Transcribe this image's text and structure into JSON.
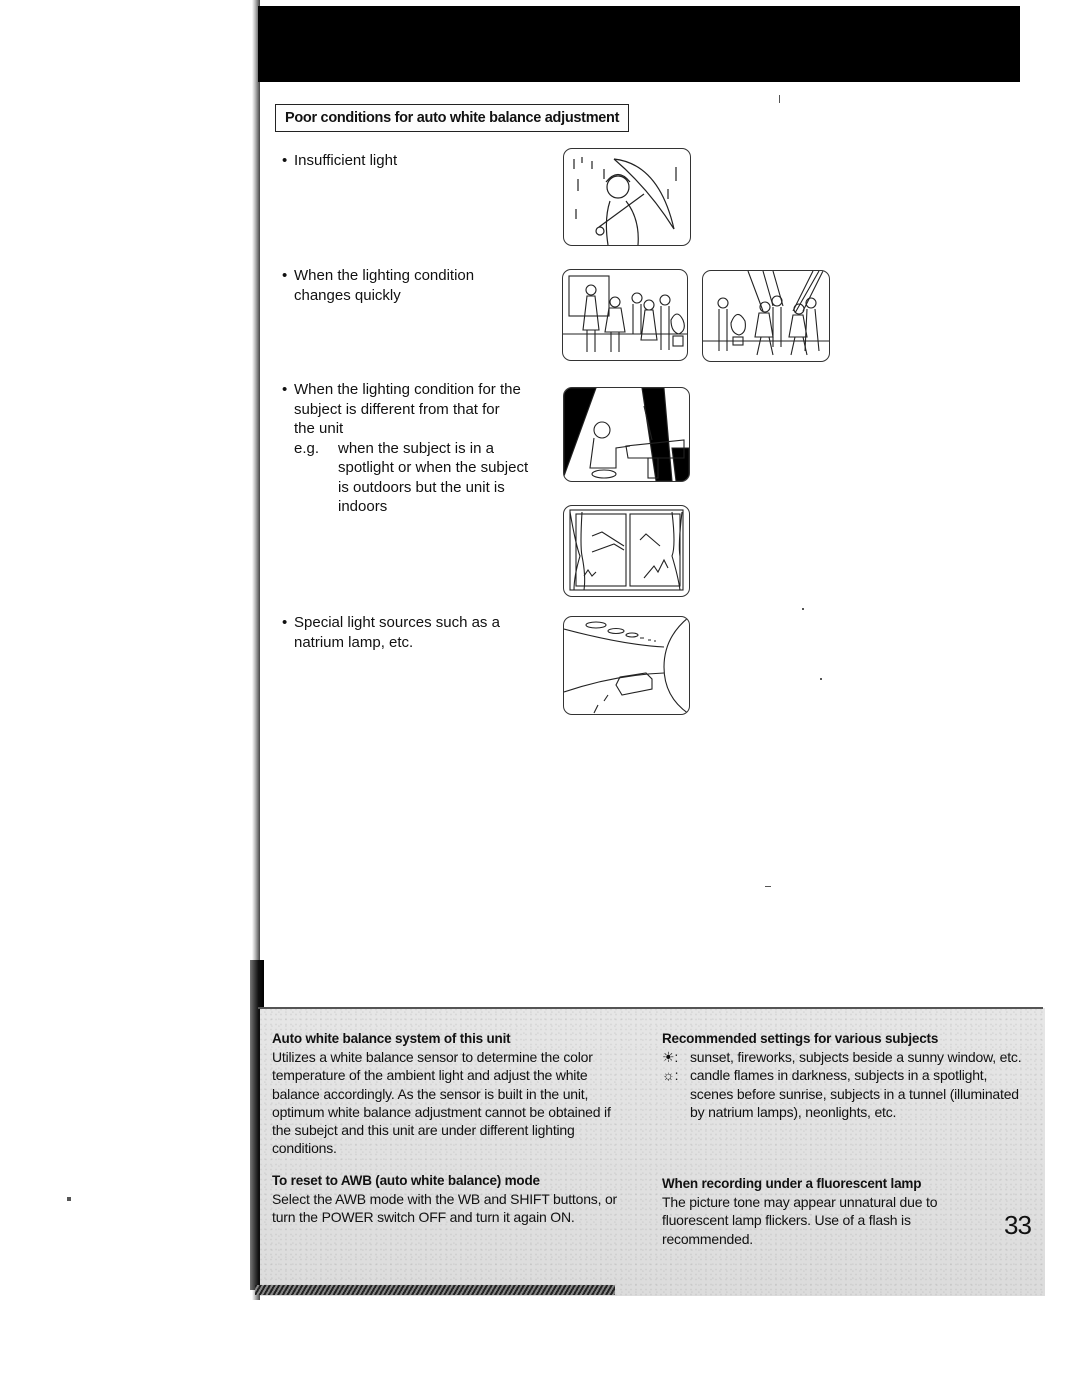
{
  "header": {
    "bar_text": ""
  },
  "section": {
    "title": "Poor conditions for auto white balance adjustment"
  },
  "conditions": [
    {
      "bullet": "•",
      "text": "Insufficient light",
      "illustration": "person-with-umbrella-in-rain-illustration"
    },
    {
      "bullet": "•",
      "text": "When the lighting condition\nchanges quickly",
      "illustrations": [
        "party-indoor-illustration",
        "dance-floor-spotlights-illustration"
      ]
    },
    {
      "bullet": "•",
      "text": "When the lighting condition for the\nsubject is different from that for\nthe unit",
      "example_label": "e.g.",
      "example_text": "when the subject is in a\nspotlight or when the subject\nis outdoors but the unit is\nindoors",
      "illustrations": [
        "pianist-in-spotlight-illustration",
        "window-with-curtains-illustration"
      ]
    },
    {
      "bullet": "•",
      "text": "Special light sources such as a\nnatrium lamp, etc.",
      "illustration": "car-in-tunnel-illustration"
    }
  ],
  "bottom": {
    "awb_system": {
      "heading": "Auto white balance system of this unit",
      "body": "Utilizes a white balance sensor to determine the color temperature of the ambient light and adjust the white balance accordingly. As the sensor is built in the unit, optimum white balance adjustment cannot be obtained if the subejct and this unit are under different lighting conditions."
    },
    "reset_awb": {
      "heading": "To reset to AWB (auto white balance) mode",
      "body": "Select the AWB mode with the WB and SHIFT buttons, or turn the POWER switch OFF and turn it again ON."
    },
    "recommended": {
      "heading": "Recommended settings for various subjects",
      "items": [
        {
          "icon": "outdoor-sun-icon",
          "glyph": "☀:",
          "text": "sunset, fireworks, subjects beside a sunny window, etc."
        },
        {
          "icon": "indoor-lamp-icon",
          "glyph": "☼:",
          "text": "candle flames in darkness, subjects in a spotlight, scenes before sunrise, subjects in a tunnel (illuminated by natrium lamps), neonlights, etc."
        }
      ]
    },
    "fluorescent": {
      "heading": "When recording under a fluorescent lamp",
      "body": "The picture tone may appear unnatural due to fluorescent lamp flickers. Use of a flash is recommended."
    }
  },
  "page_number": "33"
}
